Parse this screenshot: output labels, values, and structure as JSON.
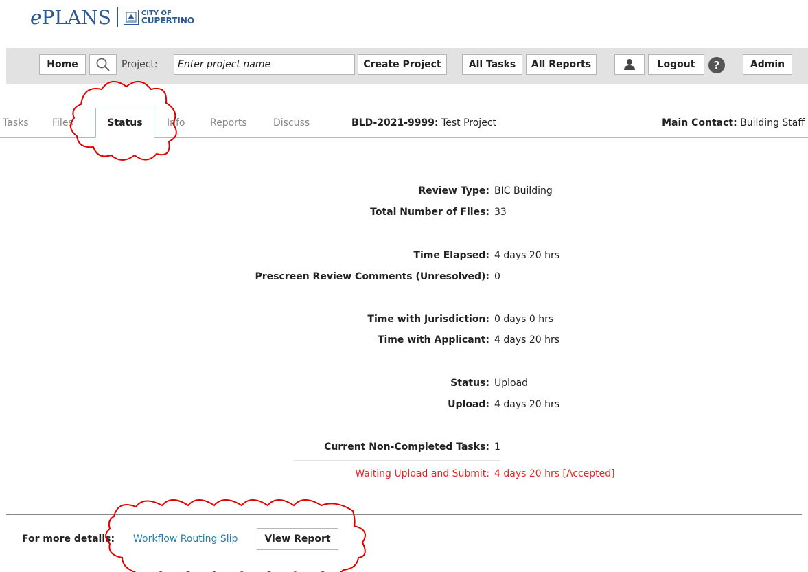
{
  "logo": {
    "e": "e",
    "plans": "PLANS",
    "city_line1": "CITY OF",
    "city_line2": "CUPERTINO"
  },
  "topbar": {
    "home": "Home",
    "project_label": "Project:",
    "project_placeholder": "Enter project name",
    "create_project": "Create Project",
    "all_tasks": "All Tasks",
    "all_reports": "All Reports",
    "logout": "Logout",
    "help": "?",
    "admin": "Admin"
  },
  "tabs": {
    "tasks": "Tasks",
    "files": "Files",
    "status": "Status",
    "info": "Info",
    "reports": "Reports",
    "discuss": "Discuss"
  },
  "project": {
    "id": "BLD-2021-9999:",
    "name": "Test Project"
  },
  "contact": {
    "label": "Main Contact:",
    "value": "Building Staff"
  },
  "status": {
    "review_type": {
      "label": "Review Type:",
      "value": "BIC Building"
    },
    "total_files": {
      "label": "Total Number of Files:",
      "value": "33"
    },
    "time_elapsed": {
      "label": "Time Elapsed:",
      "value": "4 days 20 hrs"
    },
    "prescreen": {
      "label": "Prescreen Review Comments (Unresolved):",
      "value": "0"
    },
    "time_jurisdiction": {
      "label": "Time with Jurisdiction:",
      "value": "0 days 0 hrs"
    },
    "time_applicant": {
      "label": "Time with Applicant:",
      "value": "4 days 20 hrs"
    },
    "status": {
      "label": "Status:",
      "value": "Upload"
    },
    "upload": {
      "label": "Upload:",
      "value": "4 days 20 hrs"
    },
    "current_tasks": {
      "label": "Current Non-Completed Tasks:",
      "value": "1"
    },
    "waiting": {
      "label": "Waiting Upload and Submit:",
      "value": "4 days 20 hrs [Accepted]"
    }
  },
  "footer": {
    "details_label": "For more details:",
    "workflow_link": "Workflow Routing Slip",
    "view_report": "View Report"
  },
  "colors": {
    "accent": "#2e7da6",
    "tab_border": "#8ec6dc",
    "alert": "#e82424",
    "annotation": "#e00000"
  }
}
